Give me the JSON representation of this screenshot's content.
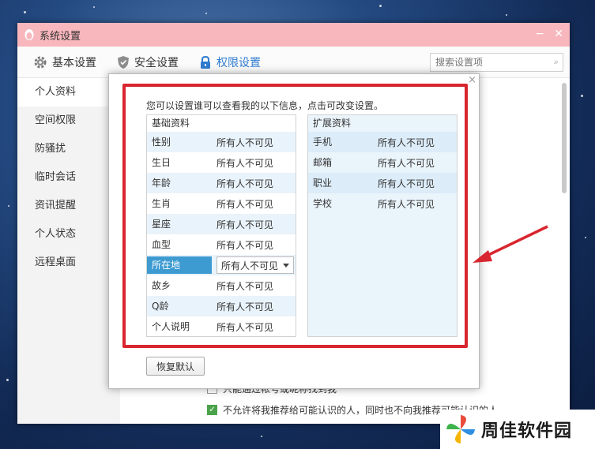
{
  "window": {
    "title": "系统设置",
    "controls": {
      "minimize": "−",
      "close": "✕"
    }
  },
  "toolbar": {
    "tabs": [
      {
        "label": "基本设置",
        "icon": "gear-icon"
      },
      {
        "label": "安全设置",
        "icon": "shield-icon"
      },
      {
        "label": "权限设置",
        "icon": "lock-icon",
        "active": true
      }
    ],
    "search_placeholder": "搜索设置项"
  },
  "sidebar": {
    "items": [
      {
        "label": "个人资料",
        "active": true
      },
      {
        "label": "空间权限"
      },
      {
        "label": "防骚扰"
      },
      {
        "label": "临时会话"
      },
      {
        "label": "资讯提醒"
      },
      {
        "label": "个人状态"
      },
      {
        "label": "远程桌面"
      }
    ]
  },
  "background_content": {
    "line1": "只能通过帐号或昵称找到我",
    "line2": "不允许将我推荐给可能认识的人，同时也不向我推荐可能认识的人"
  },
  "dialog": {
    "close": "×",
    "intro": "您可以设置谁可以查看我的以下信息，点击可改变设置。",
    "basic": {
      "header": "基础资料",
      "rows": [
        {
          "label": "性别",
          "value": "所有人不可见"
        },
        {
          "label": "生日",
          "value": "所有人不可见"
        },
        {
          "label": "年龄",
          "value": "所有人不可见"
        },
        {
          "label": "生肖",
          "value": "所有人不可见"
        },
        {
          "label": "星座",
          "value": "所有人不可见"
        },
        {
          "label": "血型",
          "value": "所有人不可见"
        },
        {
          "label": "所在地",
          "value": "所有人不可见",
          "selected": true
        },
        {
          "label": "故乡",
          "value": "所有人不可见"
        },
        {
          "label": "Q龄",
          "value": "所有人不可见"
        },
        {
          "label": "个人说明",
          "value": "所有人不可见"
        }
      ]
    },
    "extended": {
      "header": "扩展资料",
      "rows": [
        {
          "label": "手机",
          "value": "所有人不可见"
        },
        {
          "label": "邮箱",
          "value": "所有人不可见"
        },
        {
          "label": "职业",
          "value": "所有人不可见"
        },
        {
          "label": "学校",
          "value": "所有人不可见"
        }
      ]
    },
    "reset_label": "恢复默认"
  },
  "watermark": {
    "text": "周佳软件园"
  },
  "colors": {
    "titlebar": "#f8b7bd",
    "accent": "#2e7bcf",
    "selected_row": "#3d9bd1",
    "highlight_frame": "#d9252f"
  }
}
